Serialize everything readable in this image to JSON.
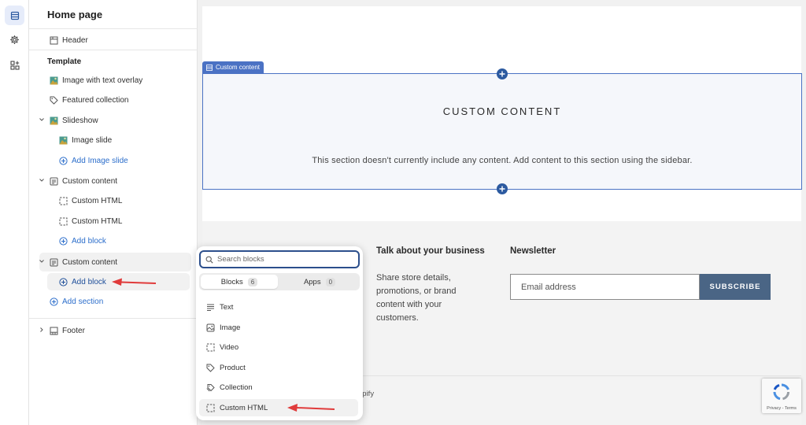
{
  "sidebar": {
    "title": "Home page",
    "header_item": "Header",
    "template_label": "Template",
    "items": [
      "Image with text overlay",
      "Featured collection",
      "Slideshow",
      "Image slide",
      "Add Image slide",
      "Custom content",
      "Custom HTML",
      "Custom HTML",
      "Add block",
      "Custom content",
      "Add block",
      "Add section",
      "Footer"
    ]
  },
  "preview": {
    "section_tag": "Custom content",
    "title": "CUSTOM CONTENT",
    "description": "This section doesn't currently include any content. Add content to this section using the sidebar.",
    "footer": {
      "col1_heading": "Talk about your business",
      "col1_text": "Share store details, promotions, or brand content with your customers.",
      "newsletter_heading": "Newsletter",
      "email_placeholder": "Email address",
      "subscribe_label": "SUBSCRIBE",
      "copyright_fragment": "opify",
      "recaptcha_text": "Privacy - Terms"
    }
  },
  "popup": {
    "search_placeholder": "Search blocks",
    "tabs": [
      {
        "label": "Blocks",
        "count": "6"
      },
      {
        "label": "Apps",
        "count": "0"
      }
    ],
    "blocks": [
      "Text",
      "Image",
      "Video",
      "Product",
      "Collection",
      "Custom HTML"
    ]
  },
  "colors": {
    "accent": "#2c6ecb",
    "selection_outline": "#4b72c4",
    "arrow": "#e03b3b",
    "subscribe_bg": "#4a6585"
  }
}
